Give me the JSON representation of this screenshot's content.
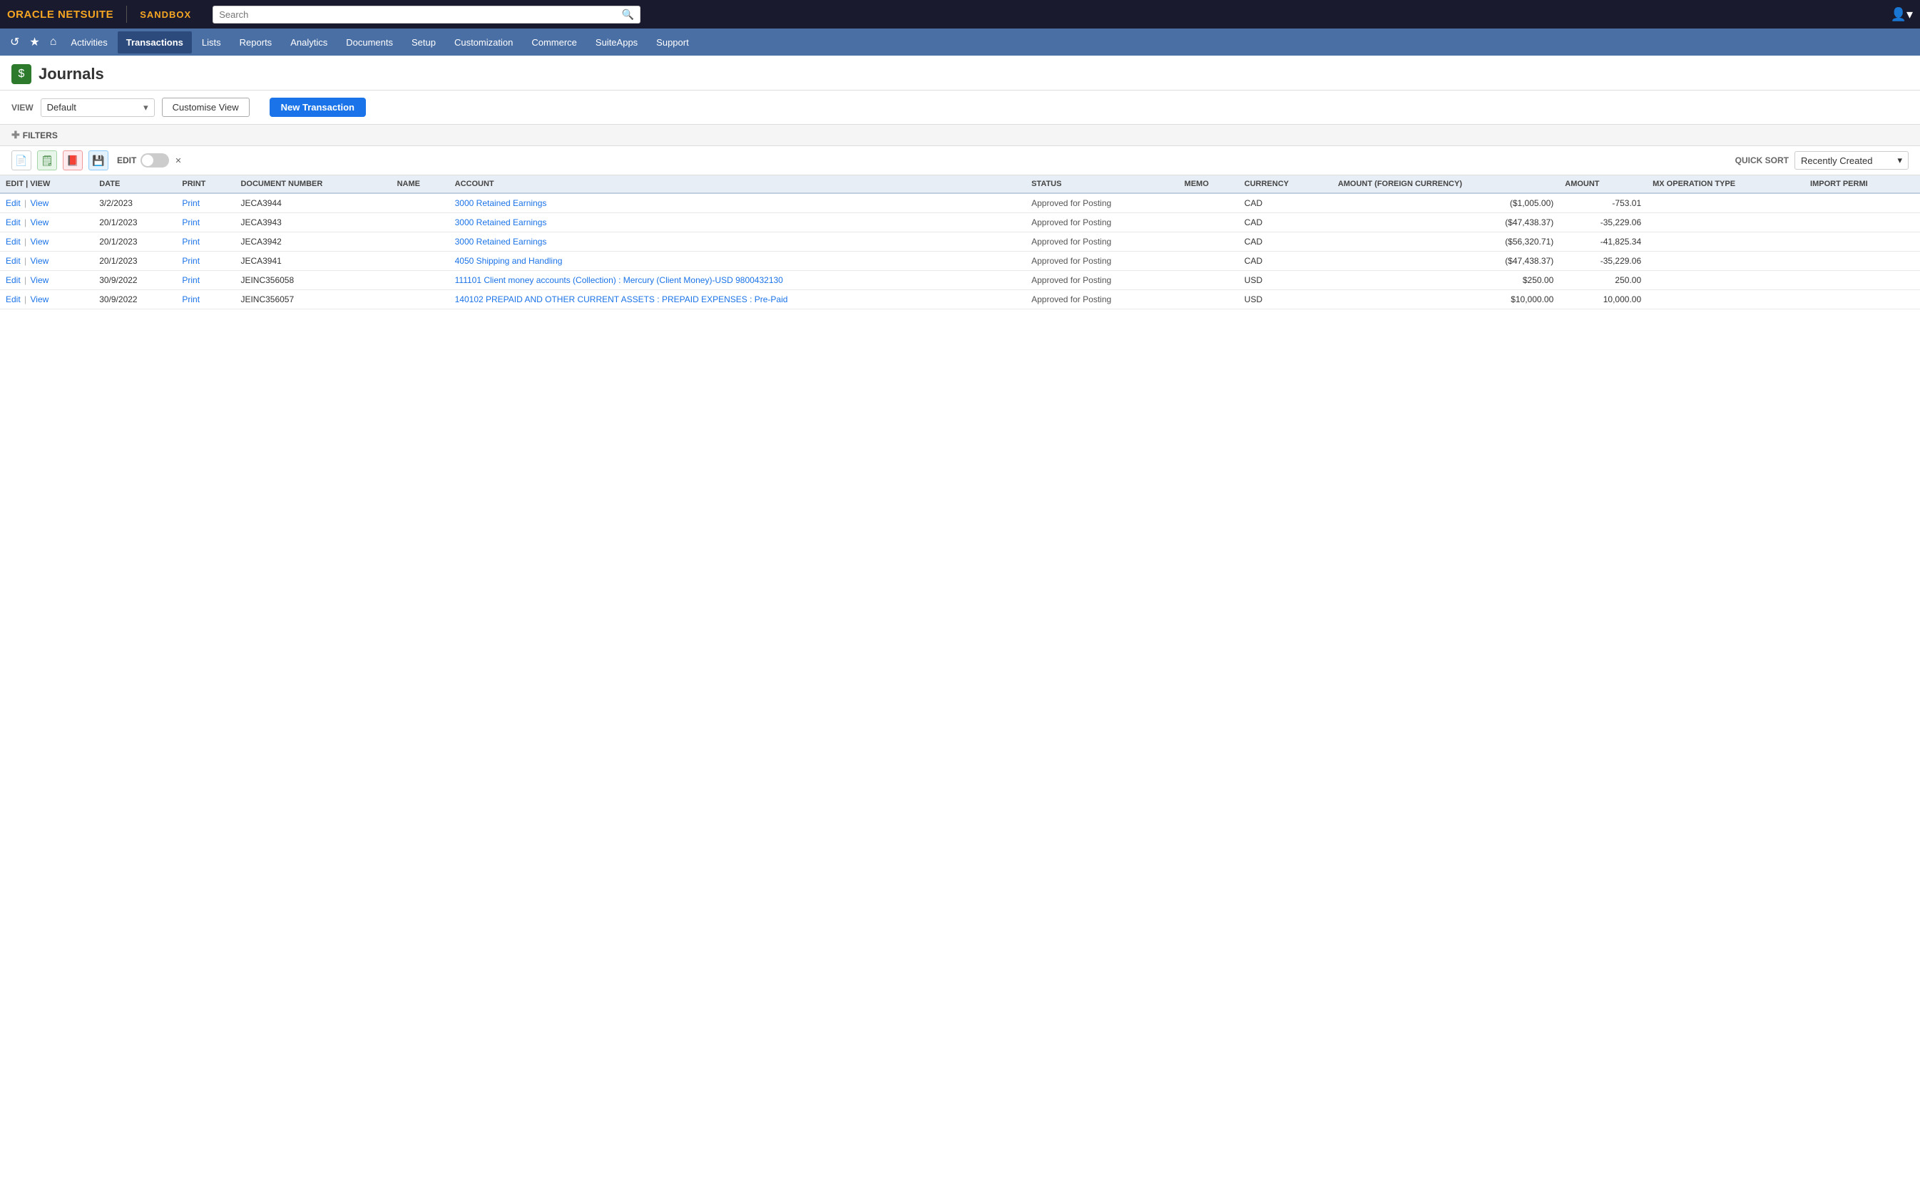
{
  "topbar": {
    "logo_text": "ORACLE NETSUITE",
    "sandbox_label": "SANDBOX",
    "search_placeholder": "Search"
  },
  "nav": {
    "icons": [
      "↺",
      "★",
      "⌂"
    ],
    "items": [
      {
        "label": "Activities",
        "active": false
      },
      {
        "label": "Transactions",
        "active": true
      },
      {
        "label": "Lists",
        "active": false
      },
      {
        "label": "Reports",
        "active": false
      },
      {
        "label": "Analytics",
        "active": false
      },
      {
        "label": "Documents",
        "active": false
      },
      {
        "label": "Setup",
        "active": false
      },
      {
        "label": "Customization",
        "active": false
      },
      {
        "label": "Commerce",
        "active": false
      },
      {
        "label": "SuiteApps",
        "active": false
      },
      {
        "label": "Support",
        "active": false
      }
    ]
  },
  "page": {
    "title": "Journals",
    "icon": "$",
    "view_label": "VIEW",
    "view_value": "Default",
    "btn_customise": "Customise View",
    "btn_new_transaction": "New Transaction",
    "filters_label": "FILTERS",
    "edit_label": "EDIT",
    "quick_sort_label": "QUICK SORT",
    "quick_sort_value": "Recently Created"
  },
  "table": {
    "columns": [
      "EDIT | VIEW",
      "DATE",
      "PRINT",
      "DOCUMENT NUMBER",
      "NAME",
      "ACCOUNT",
      "STATUS",
      "MEMO",
      "CURRENCY",
      "AMOUNT (FOREIGN CURRENCY)",
      "AMOUNT",
      "MX OPERATION TYPE",
      "IMPORT PERMI"
    ],
    "rows": [
      {
        "edit": "Edit",
        "view": "View",
        "date": "3/2/2023",
        "print": "Print",
        "doc_number": "JECA3944",
        "name": "",
        "account": "3000 Retained Earnings",
        "status": "Approved for Posting",
        "memo": "",
        "currency": "CAD",
        "amount_foreign": "($1,005.00)",
        "amount": "-753.01",
        "mx_op_type": "",
        "import_permi": ""
      },
      {
        "edit": "Edit",
        "view": "View",
        "date": "20/1/2023",
        "print": "Print",
        "doc_number": "JECA3943",
        "name": "",
        "account": "3000 Retained Earnings",
        "status": "Approved for Posting",
        "memo": "",
        "currency": "CAD",
        "amount_foreign": "($47,438.37)",
        "amount": "-35,229.06",
        "mx_op_type": "",
        "import_permi": ""
      },
      {
        "edit": "Edit",
        "view": "View",
        "date": "20/1/2023",
        "print": "Print",
        "doc_number": "JECA3942",
        "name": "",
        "account": "3000 Retained Earnings",
        "status": "Approved for Posting",
        "memo": "",
        "currency": "CAD",
        "amount_foreign": "($56,320.71)",
        "amount": "-41,825.34",
        "mx_op_type": "",
        "import_permi": ""
      },
      {
        "edit": "Edit",
        "view": "View",
        "date": "20/1/2023",
        "print": "Print",
        "doc_number": "JECA3941",
        "name": "",
        "account": "4050 Shipping and Handling",
        "status": "Approved for Posting",
        "memo": "",
        "currency": "CAD",
        "amount_foreign": "($47,438.37)",
        "amount": "-35,229.06",
        "mx_op_type": "",
        "import_permi": ""
      },
      {
        "edit": "Edit",
        "view": "View",
        "date": "30/9/2022",
        "print": "Print",
        "doc_number": "JEINC356058",
        "name": "",
        "account": "111101 Client money accounts (Collection) : Mercury (Client Money)-USD 9800432130",
        "status": "Approved for Posting",
        "memo": "",
        "currency": "USD",
        "amount_foreign": "$250.00",
        "amount": "250.00",
        "mx_op_type": "",
        "import_permi": ""
      },
      {
        "edit": "Edit",
        "view": "View",
        "date": "30/9/2022",
        "print": "Print",
        "doc_number": "JEINC356057",
        "name": "",
        "account": "140102 PREPAID AND OTHER CURRENT ASSETS : PREPAID EXPENSES : Pre-Paid",
        "status": "Approved for Posting",
        "memo": "",
        "currency": "USD",
        "amount_foreign": "$10,000.00",
        "amount": "10,000.00",
        "mx_op_type": "",
        "import_permi": ""
      }
    ]
  }
}
